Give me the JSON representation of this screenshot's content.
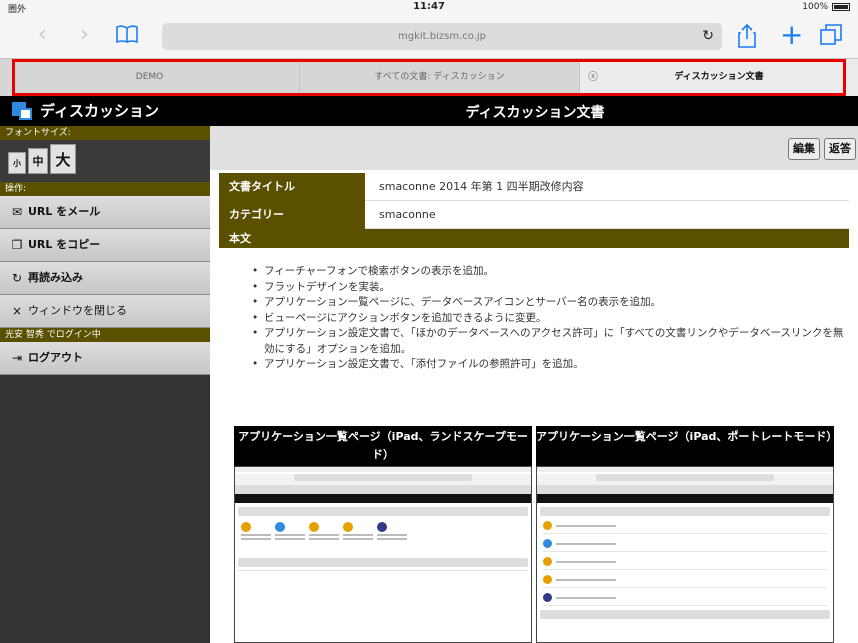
{
  "status": {
    "carrier": "圏外",
    "time": "11:47",
    "battery": "100%"
  },
  "browser": {
    "address": "mgkit.bizsm.co.jp",
    "tabs": [
      {
        "label": "DEMO"
      },
      {
        "label": "すべての文書: ディスカッション"
      },
      {
        "label": "ディスカッション文書"
      }
    ]
  },
  "app": {
    "title": "ディスカッション",
    "page_title": "ディスカッション文書"
  },
  "sidebar": {
    "font_size_header": "フォントサイズ:",
    "font_sizes": {
      "small": "小",
      "medium": "中",
      "large": "大"
    },
    "ops_header": "操作:",
    "items": [
      {
        "label": "URL をメール",
        "icon": "envelope-icon"
      },
      {
        "label": "URL をコピー",
        "icon": "copy-icon"
      },
      {
        "label": "再読み込み",
        "icon": "reload-icon"
      },
      {
        "label": "ウィンドウを閉じる",
        "icon": "close-icon"
      }
    ],
    "login_header": "光安 智秀 でログイン中",
    "logout": {
      "label": "ログアウト",
      "icon": "logout-icon"
    }
  },
  "actions": {
    "edit": "編集",
    "reply": "返答"
  },
  "document": {
    "title_label": "文書タイトル",
    "title_value": "smaconne 2014 年第 1 四半期改修内容",
    "category_label": "カテゴリー",
    "category_value": "smaconne",
    "body_label": "本文",
    "bullets": [
      "フィーチャーフォンで検索ボタンの表示を追加。",
      "フラットデザインを実装。",
      "アプリケーション一覧ページに、データベースアイコンとサーバー名の表示を追加。",
      "ビューページにアクションボタンを追加できるように変更。",
      "アプリケーション設定文書で、「ほかのデータベースへのアクセス許可」に「すべての文書リンクやデータベースリンクを無効にする」オプションを追加。",
      "アプリケーション設定文書で、「添付ファイルの参照許可」を追加。"
    ],
    "screenshots": [
      {
        "caption": "アプリケーション一覧ページ（iPad、ランドスケープモード）"
      },
      {
        "caption": "アプリケーション一覧ページ（iPad、ポートレートモード）"
      }
    ]
  },
  "colors": {
    "accent": "#5a5000",
    "highlight": "#e60000",
    "ios_blue": "#1a7cf6"
  }
}
